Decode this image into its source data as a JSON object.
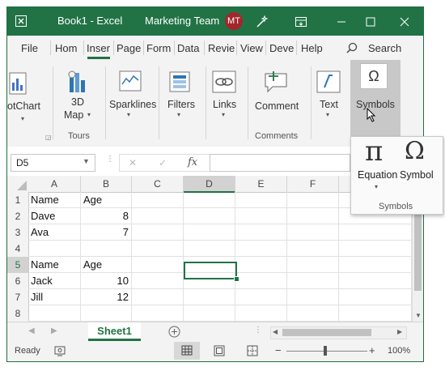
{
  "window": {
    "title": "Book1  -  Excel",
    "team": "Marketing Team",
    "avatar_initials": "MT",
    "accent_color": "#217346"
  },
  "tabs": [
    "File",
    "Hom",
    "Inser",
    "Page",
    "Form",
    "Data",
    "Revie",
    "View",
    "Deve",
    "Help"
  ],
  "active_tab": "Inser",
  "search_label": "Search",
  "ribbon": {
    "pivotchart_label": "otChart",
    "map3d_label_1": "3D",
    "map3d_label_2": "Map",
    "tours_group": "Tours",
    "sparklines_label": "Sparklines",
    "filters_label": "Filters",
    "links_label": "Links",
    "comment_label": "Comment",
    "comments_group": "Comments",
    "text_label": "Text",
    "symbols_label": "Symbols"
  },
  "symbols_popup": {
    "equation_label": "Equation",
    "symbol_label": "Symbol",
    "group_label": "Symbols",
    "pi_glyph": "π",
    "omega_glyph": "Ω"
  },
  "formula_bar": {
    "name_box": "D5",
    "cancel_glyph": "✕",
    "enter_glyph": "✓",
    "fx_glyph": "fx"
  },
  "grid": {
    "columns": [
      "A",
      "B",
      "C",
      "D",
      "E",
      "F"
    ],
    "rows": [
      "1",
      "2",
      "3",
      "4",
      "5",
      "6",
      "7",
      "8"
    ],
    "cells": [
      [
        "Name",
        "Age",
        "",
        "",
        "",
        ""
      ],
      [
        "Dave",
        "8",
        "",
        "",
        "",
        ""
      ],
      [
        "Ava",
        "7",
        "",
        "",
        "",
        ""
      ],
      [
        "",
        "",
        "",
        "",
        "",
        ""
      ],
      [
        "Name",
        "Age",
        "",
        "",
        "",
        ""
      ],
      [
        "Jack",
        "10",
        "",
        "",
        "",
        ""
      ],
      [
        "Jill",
        "12",
        "",
        "",
        "",
        ""
      ],
      [
        "",
        "",
        "",
        "",
        "",
        ""
      ]
    ],
    "selected_cell": "D5"
  },
  "sheet_tab": "Sheet1",
  "status": {
    "ready": "Ready",
    "zoom": "100%"
  }
}
